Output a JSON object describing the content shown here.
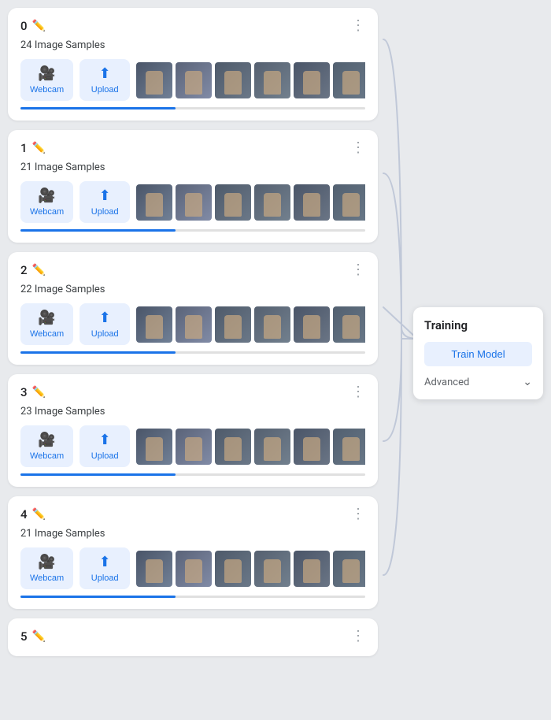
{
  "classes": [
    {
      "id": "0",
      "sample_count": "24 Image Samples",
      "thumbnails": 7
    },
    {
      "id": "1",
      "sample_count": "21 Image Samples",
      "thumbnails": 7
    },
    {
      "id": "2",
      "sample_count": "22 Image Samples",
      "thumbnails": 7
    },
    {
      "id": "3",
      "sample_count": "23 Image Samples",
      "thumbnails": 7
    },
    {
      "id": "4",
      "sample_count": "21 Image Samples",
      "thumbnails": 7
    },
    {
      "id": "5",
      "sample_count": "",
      "thumbnails": 0
    }
  ],
  "buttons": {
    "webcam": "Webcam",
    "upload": "Upload"
  },
  "training": {
    "title": "Training",
    "train_model": "Train Model",
    "advanced": "Advanced"
  },
  "colors": {
    "accent": "#1a73e8",
    "bg": "#e8eaed",
    "card_bg": "#ffffff"
  }
}
